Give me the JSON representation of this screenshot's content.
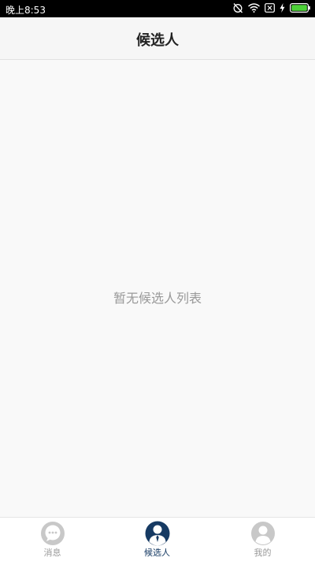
{
  "status_bar": {
    "time": "晚上8:53",
    "icons": [
      "alarm-off-icon",
      "wifi-icon",
      "sim-off-icon",
      "charging-icon",
      "battery-icon"
    ],
    "battery_color": "#4cd137"
  },
  "header": {
    "title": "候选人"
  },
  "main": {
    "empty_message": "暂无候选人列表"
  },
  "tab_bar": {
    "active_color": "#163a63",
    "inactive_color": "#c8c8c8",
    "tabs": [
      {
        "label": "消息",
        "icon": "message-icon",
        "active": false
      },
      {
        "label": "候选人",
        "icon": "candidate-icon",
        "active": true
      },
      {
        "label": "我的",
        "icon": "profile-icon",
        "active": false
      }
    ]
  }
}
